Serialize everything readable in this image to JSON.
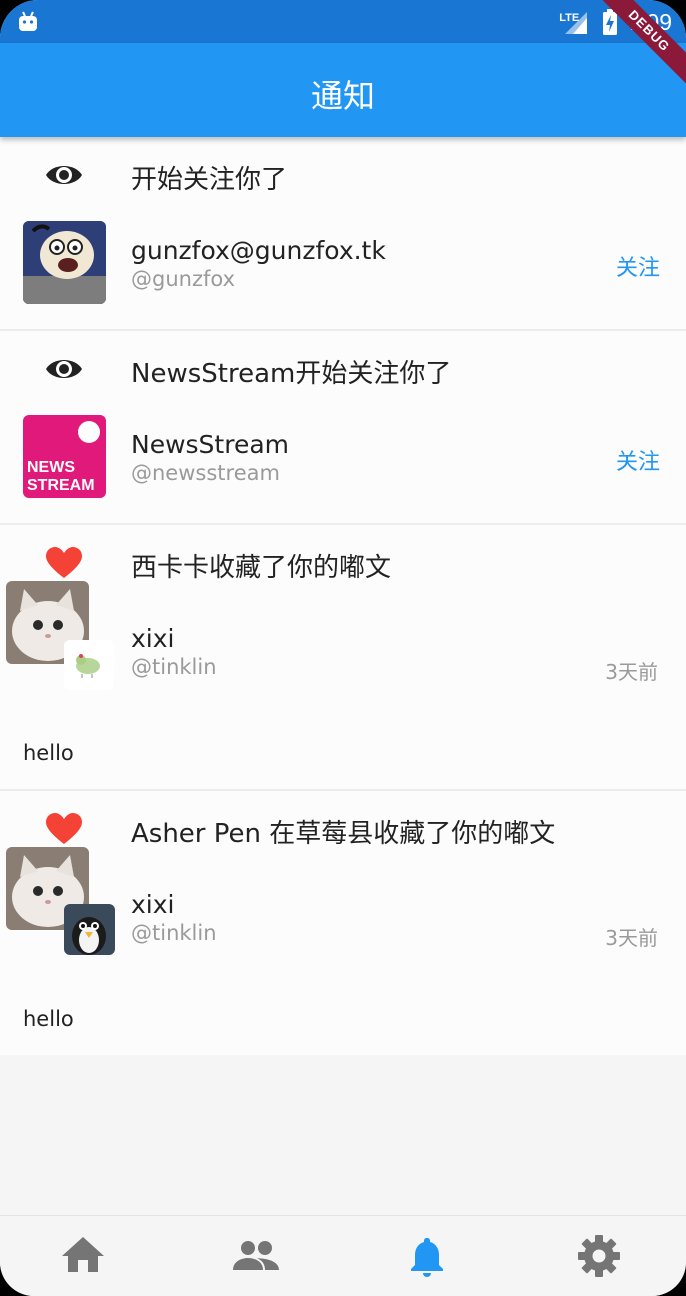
{
  "status_bar": {
    "network": "LTE",
    "time": "7:09",
    "debug_banner": "DEBUG"
  },
  "app_bar": {
    "title": "通知"
  },
  "notifications": [
    {
      "type": "follow",
      "icon": "eye-icon",
      "headline": "开始关注你了",
      "name": "gunzfox@gunzfox.tk",
      "handle": "@gunzfox",
      "action": "关注"
    },
    {
      "type": "follow",
      "icon": "eye-icon",
      "headline": "NewsStream开始关注你了",
      "name": "NewsStream",
      "handle": "@newsstream",
      "action": "关注",
      "avatar_text": [
        "NEWS",
        "STREAM"
      ]
    },
    {
      "type": "favourite",
      "icon": "heart-icon",
      "headline": "西卡卡收藏了你的嘟文",
      "name": "xixi",
      "handle": "@tinklin",
      "time": "3天前",
      "content": "hello"
    },
    {
      "type": "favourite",
      "icon": "heart-icon",
      "headline": "Asher Pen 在草莓县收藏了你的嘟文",
      "name": "xixi",
      "handle": "@tinklin",
      "time": "3天前",
      "content": "hello"
    }
  ],
  "bottom_nav": [
    {
      "icon": "home-icon",
      "active": false
    },
    {
      "icon": "people-icon",
      "active": false
    },
    {
      "icon": "bell-icon",
      "active": true
    },
    {
      "icon": "gear-icon",
      "active": false
    }
  ],
  "colors": {
    "primary": "#2196F3",
    "status_bar": "#1976D2",
    "heart": "#F44336",
    "inactive_icon": "#757575"
  }
}
